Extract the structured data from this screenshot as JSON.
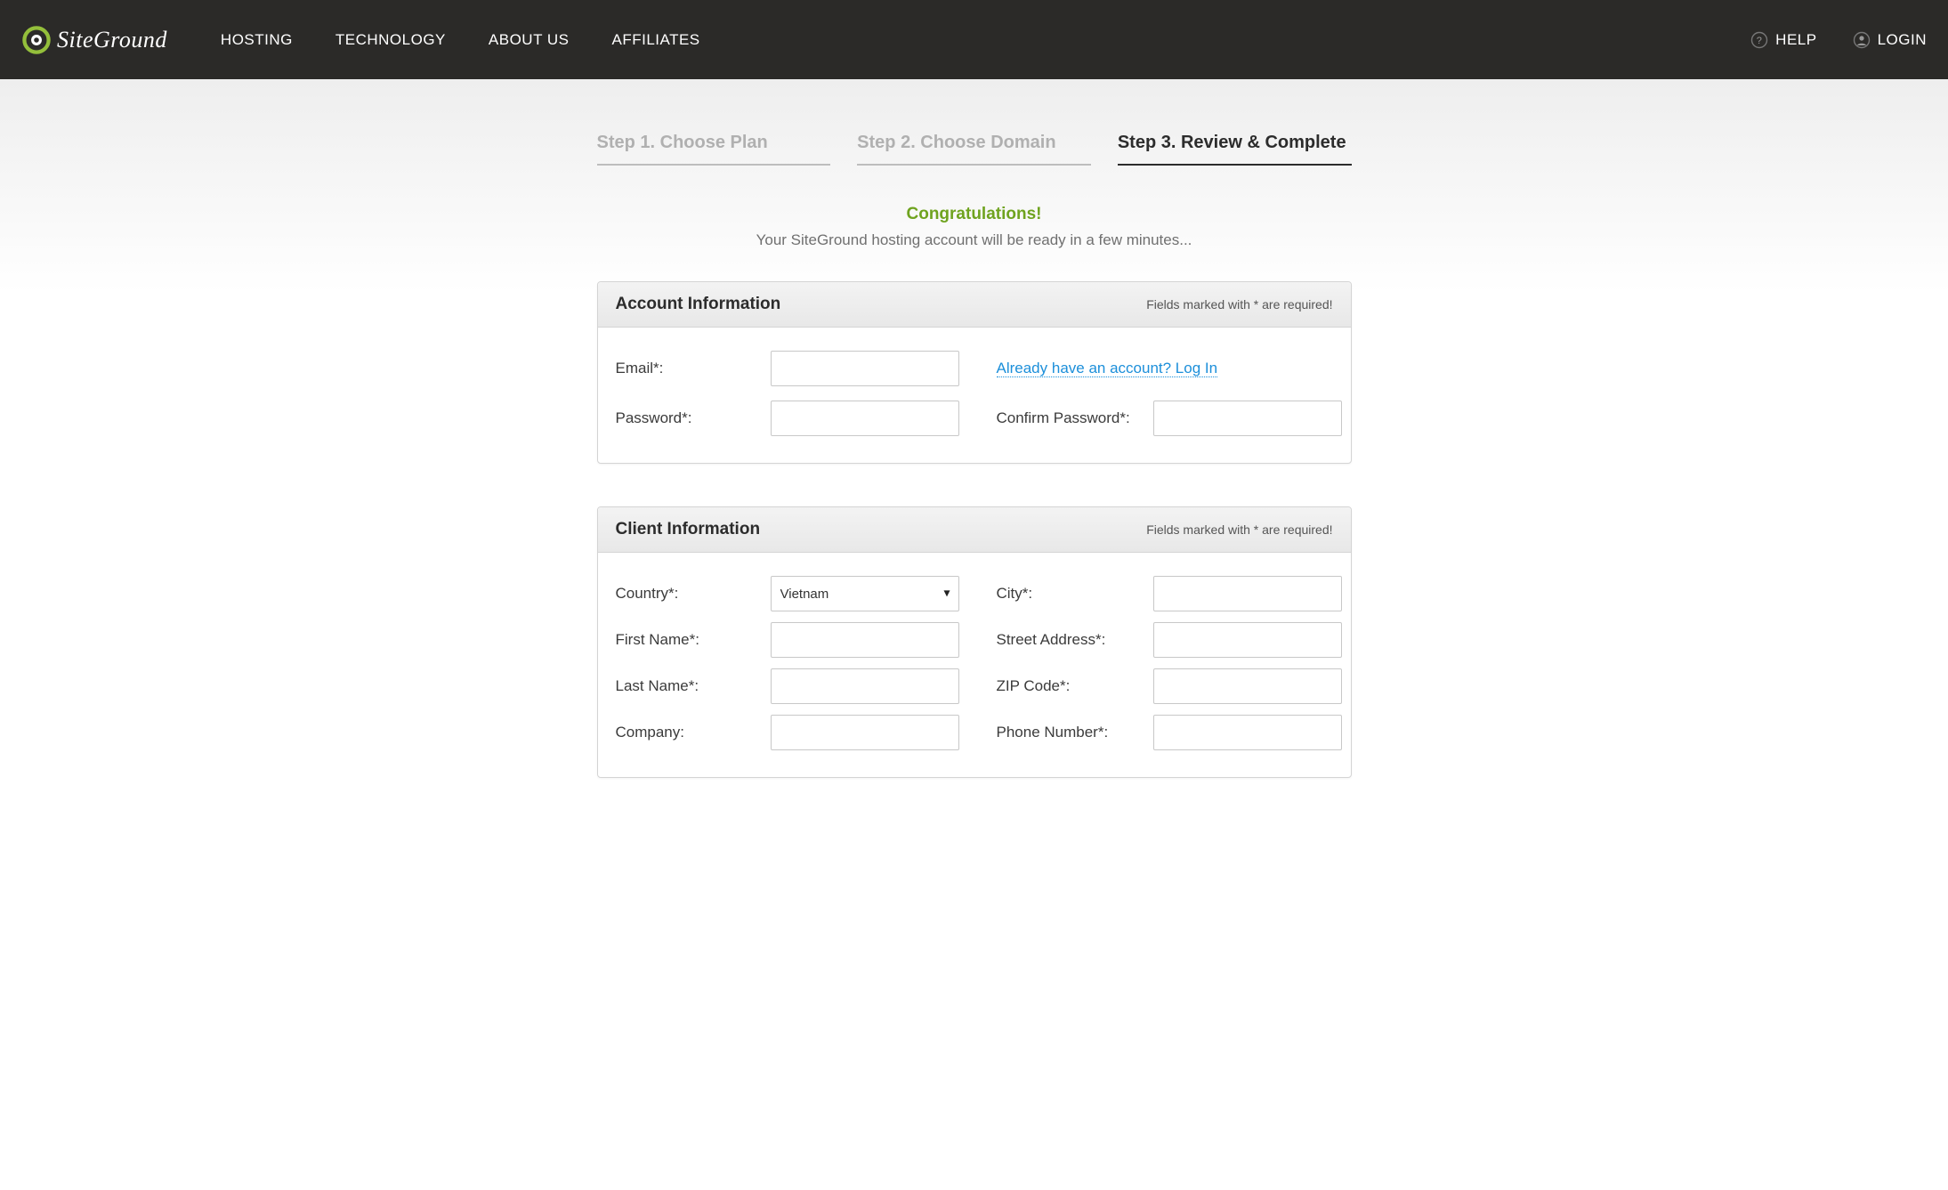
{
  "nav": {
    "hosting": "HOSTING",
    "technology": "TECHNOLOGY",
    "about": "ABOUT US",
    "affiliates": "AFFILIATES",
    "help": "HELP",
    "login": "LOGIN"
  },
  "steps": {
    "s1": "Step 1. Choose Plan",
    "s2": "Step 2. Choose Domain",
    "s3": "Step 3. Review & Complete"
  },
  "congrats": "Congratulations!",
  "subline": "Your SiteGround hosting account will be ready in a few minutes...",
  "account": {
    "title": "Account Information",
    "required_note": "Fields marked with * are required!",
    "email_label": "Email*:",
    "password_label": "Password*:",
    "confirm_password_label": "Confirm Password*:",
    "login_link": "Already have an account? Log In"
  },
  "client": {
    "title": "Client Information",
    "required_note": "Fields marked with * are required!",
    "country_label": "Country*:",
    "country_value": "Vietnam",
    "first_name_label": "First Name*:",
    "last_name_label": "Last Name*:",
    "company_label": "Company:",
    "city_label": "City*:",
    "street_label": "Street Address*:",
    "zip_label": "ZIP Code*:",
    "phone_label": "Phone Number*:"
  }
}
